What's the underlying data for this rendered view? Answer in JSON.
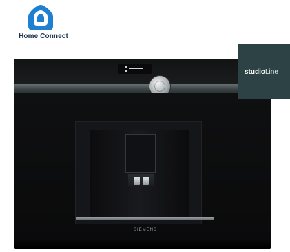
{
  "home_connect": {
    "label": "Home Connect",
    "icon": "home-connect-house-icon",
    "color": "#1f7fd1"
  },
  "studio_tag": {
    "bold_text": "studio",
    "light_text": "Line",
    "background": "#2d4244"
  },
  "appliance": {
    "icon": "built-in-coffee-machine-image",
    "brand_plate_text": "SIEMENS"
  }
}
